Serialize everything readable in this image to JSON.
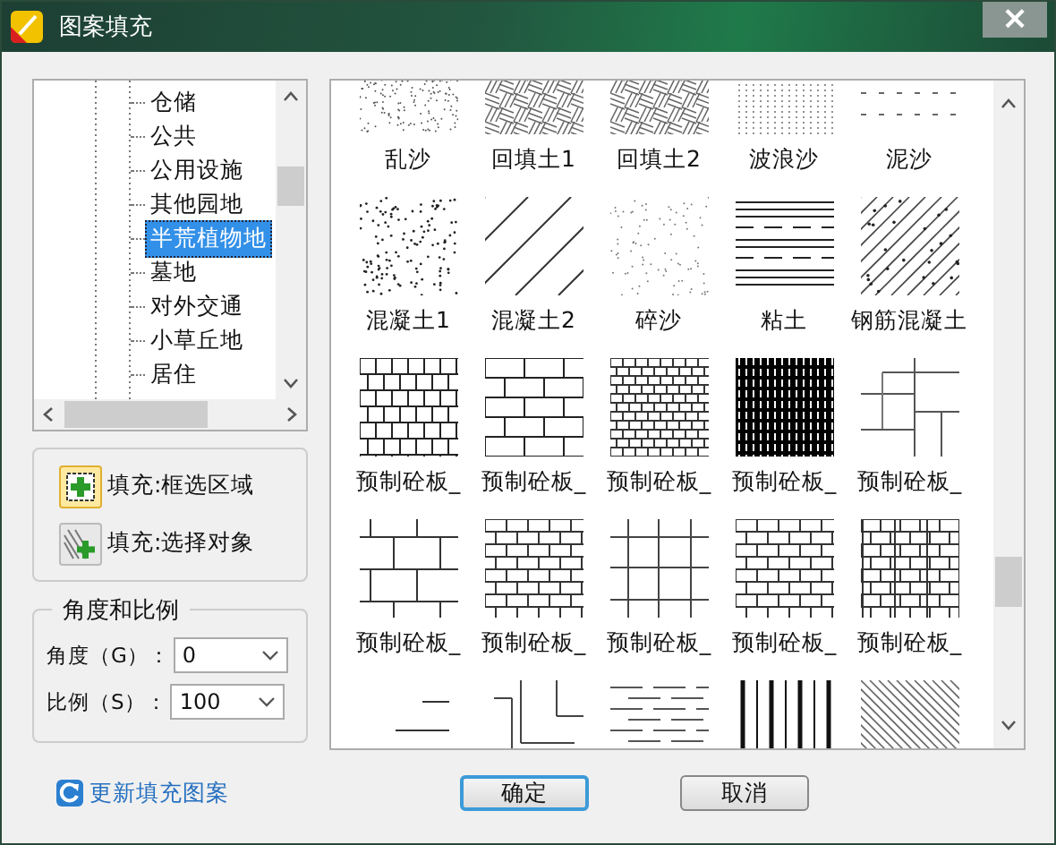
{
  "window": {
    "title": "图案填充",
    "close": "×"
  },
  "tree": {
    "items": [
      {
        "label": "仓储",
        "selected": false
      },
      {
        "label": "公共",
        "selected": false
      },
      {
        "label": "公用设施",
        "selected": false
      },
      {
        "label": "其他园地",
        "selected": false
      },
      {
        "label": "半荒植物地",
        "selected": true
      },
      {
        "label": "墓地",
        "selected": false
      },
      {
        "label": "对外交通",
        "selected": false
      },
      {
        "label": "小草丘地",
        "selected": false
      },
      {
        "label": "居住",
        "selected": false
      }
    ]
  },
  "fill_tools": [
    {
      "label": "填充:框选区域",
      "kind": "region",
      "selected": true
    },
    {
      "label": "填充:选择对象",
      "kind": "object",
      "selected": false
    }
  ],
  "angle_scale": {
    "title": "角度和比例",
    "fields": [
      {
        "label": "角度（G）：",
        "value": "0"
      },
      {
        "label": "比例（S）：",
        "value": "100"
      }
    ]
  },
  "patterns": [
    {
      "label": "乱沙",
      "kind": "sand"
    },
    {
      "label": "回填土1",
      "kind": "weave"
    },
    {
      "label": "回填土2",
      "kind": "weave"
    },
    {
      "label": "波浪沙",
      "kind": "vdots"
    },
    {
      "label": "泥沙",
      "kind": "dashes"
    },
    {
      "label": "混凝土1",
      "kind": "dots"
    },
    {
      "label": "混凝土2",
      "kind": "slash"
    },
    {
      "label": "碎沙",
      "kind": "finedots"
    },
    {
      "label": "粘土",
      "kind": "hlines"
    },
    {
      "label": "钢筋混凝土",
      "kind": "slashdots"
    },
    {
      "label": "预制砼板_",
      "kind": "basket"
    },
    {
      "label": "预制砼板_",
      "kind": "brick"
    },
    {
      "label": "预制砼板_",
      "kind": "densebrick"
    },
    {
      "label": "预制砼板_",
      "kind": "black"
    },
    {
      "label": "预制砼板_",
      "kind": "parquet"
    },
    {
      "label": "预制砼板_",
      "kind": "tile"
    },
    {
      "label": "预制砼板_",
      "kind": "smallbrick"
    },
    {
      "label": "预制砼板_",
      "kind": "grid"
    },
    {
      "label": "预制砼板_",
      "kind": "smallbrick"
    },
    {
      "label": "预制砼板_",
      "kind": "doublebrick"
    },
    {
      "kind": "corner"
    },
    {
      "kind": "pipes"
    },
    {
      "kind": "hdash"
    },
    {
      "kind": "vbars"
    },
    {
      "kind": "diag"
    }
  ],
  "update_link": "更新填充图案",
  "buttons": [
    {
      "label": "确定",
      "default": true
    },
    {
      "label": "取消",
      "default": false
    }
  ]
}
